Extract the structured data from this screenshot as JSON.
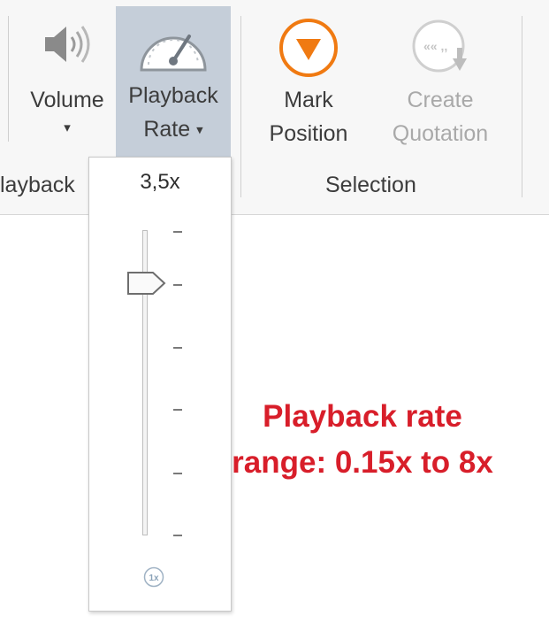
{
  "ribbon": {
    "buttons": {
      "volume": {
        "label": "Volume",
        "caret": "▾",
        "icon": "speaker-icon"
      },
      "playback_rate": {
        "label_line1": "Playback",
        "label_line2": "Rate",
        "caret": "▾",
        "icon": "speedometer-icon"
      },
      "mark_position": {
        "label_line1": "Mark",
        "label_line2": "Position",
        "icon": "mark-down-arrow-icon"
      },
      "create_quotation": {
        "label_line1": "Create",
        "label_line2": "Quotation",
        "icon": "quotation-icon",
        "enabled": false
      }
    },
    "groups": {
      "playback_partial": "layback",
      "selection": "Selection"
    }
  },
  "rate_popup": {
    "value": "3,5x",
    "reset_label": "1x",
    "slider_level_fraction_from_top": 0.17
  },
  "annotation": {
    "line1": "Playback rate",
    "line2": "range: 0.15x to 8x"
  },
  "colors": {
    "accent_orange": "#f07a12",
    "annotation_red": "#d81e2a",
    "active_button_bg": "#c5ced9"
  }
}
